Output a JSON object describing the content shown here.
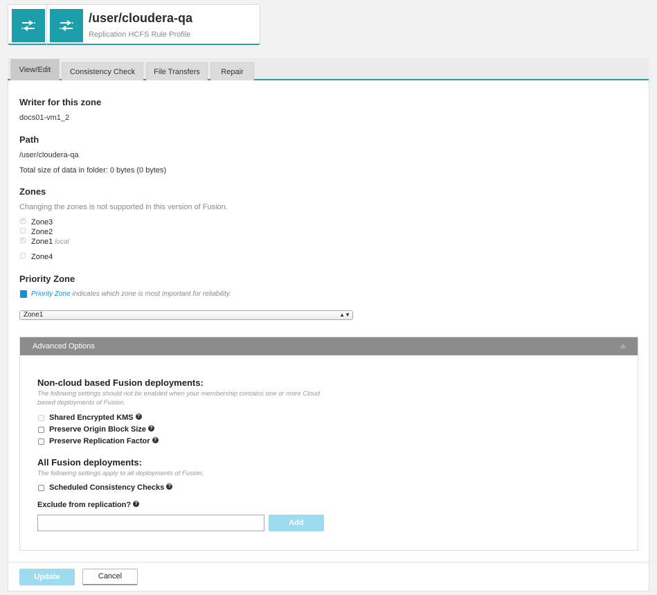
{
  "header": {
    "title": "/user/cloudera-qa",
    "subtitle": "Replication HCFS Rule Profile",
    "icon": "replication-arrows-icon",
    "accent_color": "#1c9eab"
  },
  "tabs": [
    {
      "label": "View/Edit",
      "active": true
    },
    {
      "label": "Consistency Check",
      "active": false
    },
    {
      "label": "File Transfers",
      "active": false
    },
    {
      "label": "Repair",
      "active": false
    }
  ],
  "writer": {
    "heading": "Writer for this zone",
    "value": "docs01-vm1_2"
  },
  "path": {
    "heading": "Path",
    "value": "/user/cloudera-qa",
    "size_text": "Total size of data in folder: 0 bytes (0 bytes)"
  },
  "zones": {
    "heading": "Zones",
    "note": "Changing the zones is not supported in this version of Fusion.",
    "items": [
      {
        "label": "Zone3",
        "checked": true,
        "tag": ""
      },
      {
        "label": "Zone2",
        "checked": false,
        "tag": ""
      },
      {
        "label": "Zone1",
        "checked": true,
        "tag": "local"
      },
      {
        "label": "Zone4",
        "checked": false,
        "tag": ""
      }
    ]
  },
  "priority": {
    "heading": "Priority Zone",
    "link_text": "Priority Zone",
    "desc": "indicates which zone is most important for reliability.",
    "selected": "Zone1",
    "icon": "book-icon"
  },
  "advanced": {
    "title": "Advanced Options",
    "noncloud_heading": "Non-cloud based Fusion deployments:",
    "noncloud_note": "The following settings should not be enabled when your membership contains one or more Cloud based deployments of Fusion.",
    "options": [
      {
        "label": "Shared Encrypted KMS",
        "disabled": true
      },
      {
        "label": "Preserve Origin Block Size",
        "disabled": false
      },
      {
        "label": "Preserve Replication Factor",
        "disabled": false
      }
    ],
    "all_heading": "All Fusion deployments:",
    "all_note": "The following settings apply to all deployments of Fusion.",
    "scheduled_label": "Scheduled Consistency Checks",
    "exclude_label": "Exclude from replication?",
    "exclude_value": "",
    "add_label": "Add"
  },
  "footer": {
    "update_label": "Update",
    "cancel_label": "Cancel"
  }
}
